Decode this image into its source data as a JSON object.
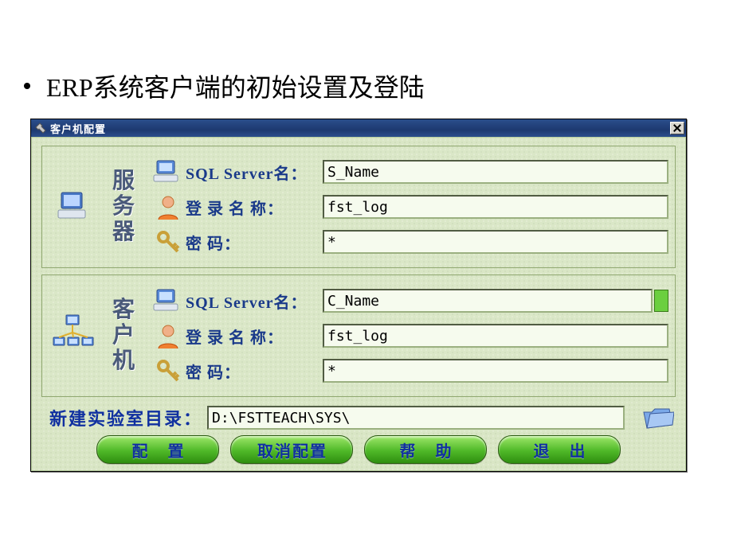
{
  "slide": {
    "bullet": "ERP系统客户端的初始设置及登陆"
  },
  "window": {
    "title": "客户机配置"
  },
  "server": {
    "heading": "服务器",
    "sql_label": "SQL Server名：",
    "sql_value": "S_Name",
    "login_label": "登 录 名 称：",
    "login_value": "fst_log",
    "pwd_label": "密        码：",
    "pwd_value": "*"
  },
  "client": {
    "heading": "客户机",
    "sql_label": "SQL Server名：",
    "sql_value": "C_Name",
    "login_label": "登 录 名 称：",
    "login_value": "fst_log",
    "pwd_label": "密        码：",
    "pwd_value": "*"
  },
  "dir": {
    "label": "新建实验室目录：",
    "value": "D:\\FSTTEACH\\SYS\\"
  },
  "buttons": {
    "config": "配 置",
    "cancel": "取消配置",
    "help": "帮 助",
    "exit": "退 出"
  }
}
